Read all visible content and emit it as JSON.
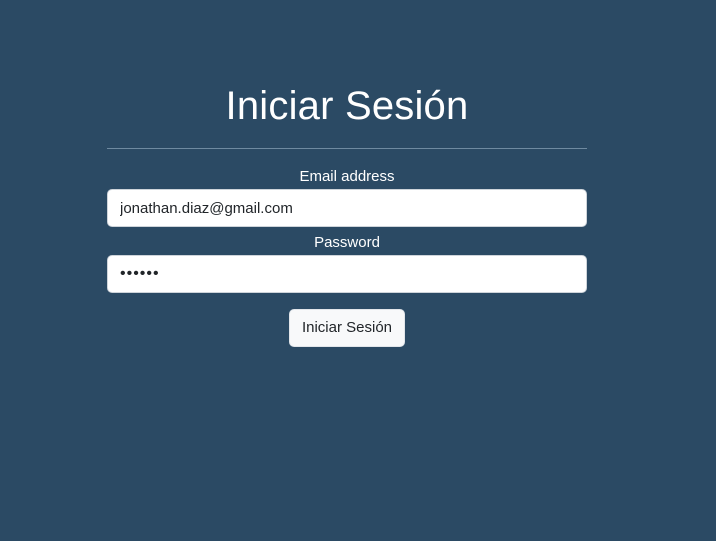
{
  "login": {
    "title": "Iniciar Sesión",
    "email": {
      "label": "Email address",
      "value": "jonathan.diaz@gmail.com"
    },
    "password": {
      "label": "Password",
      "value": "123456"
    },
    "submit_label": "Iniciar Sesión"
  },
  "colors": {
    "background": "#2b4a64",
    "text": "#ffffff",
    "button_bg": "#f8f9fa"
  }
}
